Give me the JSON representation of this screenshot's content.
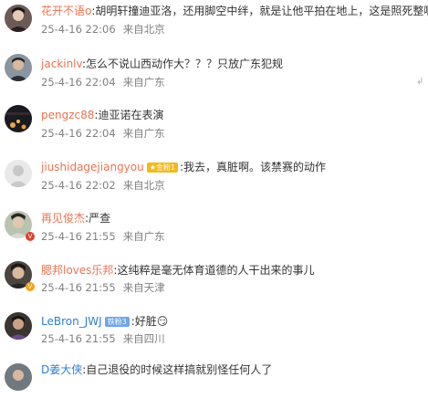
{
  "colors": {
    "username": "#eb7350",
    "text": "#333333",
    "meta": "#808080"
  },
  "comments": [
    {
      "user": "花开不语o",
      "colon": ":",
      "text": "胡明轩撞迪亚洛，还用脚空中绊，就是让他平拍在地上，这是照死整啊",
      "time": "25-4-16 22:06",
      "location": "来自北京"
    },
    {
      "user": "jackinlv",
      "colon": ":",
      "text": "怎么不说山西动作大？？？只放广东犯规",
      "time": "25-4-16 22:04",
      "location": "来自广东"
    },
    {
      "user": "pengzc88",
      "colon": ":",
      "text": "迪亚诺在表演",
      "time": "25-4-16 22:04",
      "location": "来自广东"
    },
    {
      "user": "jiushidagejiangyou",
      "badge": "★金粉1",
      "colon": ":",
      "text": "我去，真脏啊。该禁赛的动作",
      "time": "25-4-16 22:02",
      "location": "来自北京"
    },
    {
      "user": "再见俊杰",
      "colon": ":",
      "text": "严查",
      "time": "25-4-16 21:55",
      "location": "来自广东"
    },
    {
      "user": "腮邦loves乐邦",
      "colon": ":",
      "text": "这纯粹是毫无体育道德的人干出来的事儿",
      "time": "25-4-16 21:55",
      "location": "来自天津"
    },
    {
      "user": "LeBron_JWJ",
      "badge": "铁粉3",
      "colon": ":",
      "text": "好脏😏",
      "time": "25-4-16 21:55",
      "location": "来自四川"
    },
    {
      "user": "D姜大侠",
      "colon": ":",
      "text": "自己退役的时候这样搞就别怪任何人了"
    }
  ],
  "icons": {
    "reply": "reply-icon"
  }
}
